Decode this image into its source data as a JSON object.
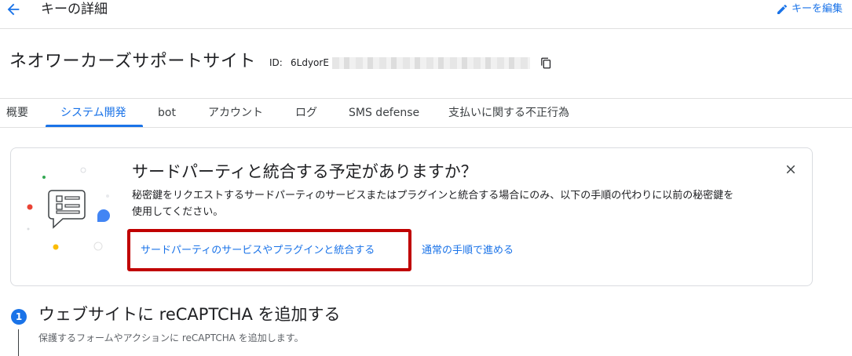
{
  "topbar": {
    "title": "キーの詳細",
    "edit_label": "キーを編集"
  },
  "header": {
    "site_name": "ネオワーカーズサポートサイト",
    "id_label": "ID:",
    "id_value_visible": "6LdyorE"
  },
  "tabs": [
    {
      "label": "概要"
    },
    {
      "label": "システム開発"
    },
    {
      "label": "bot"
    },
    {
      "label": "アカウント"
    },
    {
      "label": "ログ"
    },
    {
      "label": "SMS defense"
    },
    {
      "label": "支払いに関する不正行為"
    }
  ],
  "active_tab": "システム開発",
  "card": {
    "title": "サードパーティと統合する予定がありますか？",
    "body_line1": "秘密鍵をリクエストするサードパーティのサービスまたはプラグインと統合する場合にのみ、以下の手順の代わりに以前の秘密鍵を",
    "body_line2": "使用してください。",
    "primary_button": "サードパーティのサービスやプラグインと統合する",
    "secondary_button": "通常の手順で進める"
  },
  "step": {
    "number": "1",
    "title": "ウェブサイトに reCAPTCHA を追加する",
    "description": "保護するフォームやアクションに reCAPTCHA を追加します。"
  },
  "colors": {
    "accent": "#1a73e8",
    "highlight_border": "#c00000",
    "divider": "#e0e0e0"
  },
  "icons": {
    "back": "back-arrow-icon",
    "edit": "pencil-icon",
    "copy": "copy-icon",
    "close": "close-icon"
  }
}
